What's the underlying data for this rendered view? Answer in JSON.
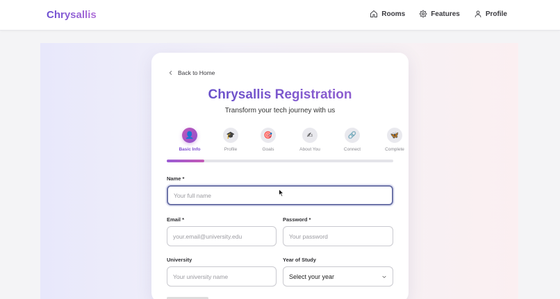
{
  "header": {
    "brand": "Chrysallis",
    "nav": [
      {
        "label": "Rooms",
        "icon": "home-icon"
      },
      {
        "label": "Features",
        "icon": "gear-icon"
      },
      {
        "label": "Profile",
        "icon": "user-icon"
      }
    ]
  },
  "card": {
    "back_label": "Back to Home",
    "title": "Chrysallis Registration",
    "subtitle": "Transform your tech journey with us",
    "steps": [
      {
        "label": "Basic Info",
        "glyph": "👤",
        "active": true
      },
      {
        "label": "Profile",
        "glyph": "🎓",
        "active": false
      },
      {
        "label": "Goals",
        "glyph": "🎯",
        "active": false
      },
      {
        "label": "About You",
        "glyph": "✍",
        "active": false
      },
      {
        "label": "Connect",
        "glyph": "🔗",
        "active": false
      },
      {
        "label": "Complete",
        "glyph": "🦋",
        "active": false
      }
    ],
    "progress_fraction": 0.167
  },
  "form": {
    "name": {
      "label": "Name *",
      "placeholder": "Your full name",
      "value": ""
    },
    "email": {
      "label": "Email *",
      "placeholder": "your.email@university.edu",
      "value": ""
    },
    "password": {
      "label": "Password *",
      "placeholder": "Your password",
      "value": ""
    },
    "university": {
      "label": "University",
      "placeholder": "Your university name",
      "value": ""
    },
    "year": {
      "label": "Year of Study",
      "selected": "Select your year"
    }
  },
  "colors": {
    "accent_start": "#6c4fd1",
    "accent_end": "#b06fd8",
    "step_active": "#8e51cf"
  }
}
